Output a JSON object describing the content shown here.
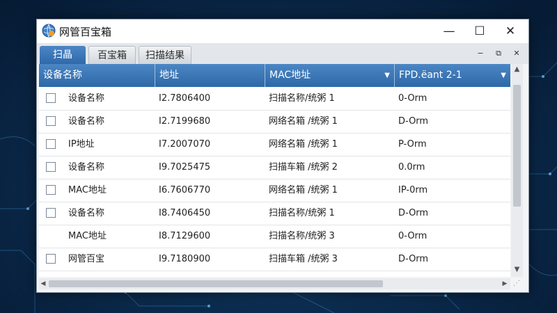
{
  "window": {
    "title": "网管百宝箱",
    "minimize_glyph": "—",
    "maximize_glyph": "☐",
    "close_glyph": "✕"
  },
  "tabs": [
    {
      "label": "扫晶",
      "active": true
    },
    {
      "label": "百宝箱",
      "active": false
    },
    {
      "label": "扫描结果",
      "active": false
    }
  ],
  "panel_controls": {
    "minimize": "−",
    "restore": "⧉",
    "close": "✕"
  },
  "table": {
    "columns": [
      {
        "label": "设备名称",
        "has_dropdown": false
      },
      {
        "label": "地址",
        "has_dropdown": false
      },
      {
        "label": "MAC地址",
        "has_dropdown": true
      },
      {
        "label": "FPD.ёant 2-1",
        "has_dropdown": true
      }
    ],
    "rows": [
      {
        "checkbox": true,
        "name": "设备名称",
        "address": "I2.7806400",
        "mac": "扫描名称/统粥 1",
        "status": "0-Orm"
      },
      {
        "checkbox": true,
        "name": "设备名称",
        "address": "I2.7199680",
        "mac": "网络名箱 /统粥 1",
        "status": "D-Orm"
      },
      {
        "checkbox": true,
        "name": "IP地址",
        "address": "I7.2007070",
        "mac": "网络名箱 /统粥 1",
        "status": "P-Orm"
      },
      {
        "checkbox": true,
        "name": "设备名称",
        "address": "I9.7025475",
        "mac": "扫描车箱 /统粥 2",
        "status": "0.0rm"
      },
      {
        "checkbox": true,
        "name": "MAC地址",
        "address": "I6.7606770",
        "mac": "网络名箱 /统粥 1",
        "status": "IP-0rm"
      },
      {
        "checkbox": true,
        "name": "设备名称",
        "address": "I8.7406450",
        "mac": "扫描名称/统粥 1",
        "status": "D-Orm"
      },
      {
        "checkbox": false,
        "name": "MAC地址",
        "address": "I8.7129600",
        "mac": "扫描名称/统粥 3",
        "status": "0-Orm"
      },
      {
        "checkbox": true,
        "name": "网管百宝",
        "address": "I9.7180900",
        "mac": "扫描车箱 /统粥 3",
        "status": "D-Orm"
      }
    ]
  },
  "colors": {
    "accent": "#2f69aa",
    "header_top": "#4b86c4"
  }
}
